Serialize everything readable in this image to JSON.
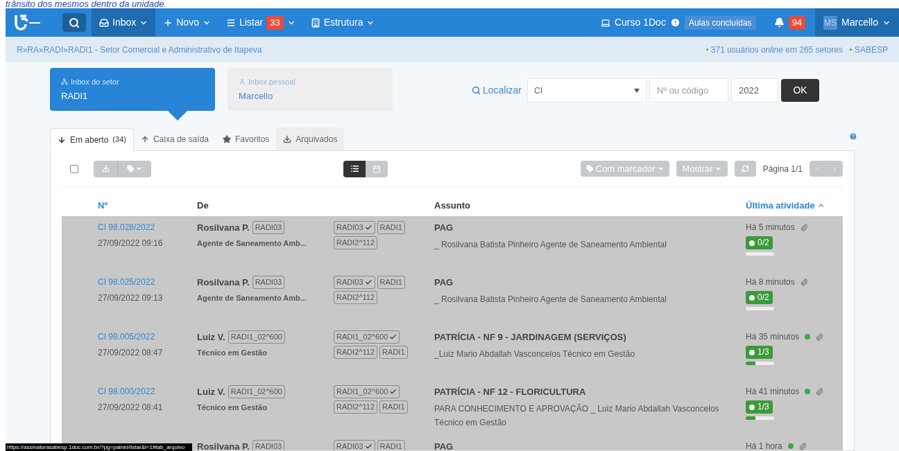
{
  "caption": "trânsito dos mesmos dentro da unidade.",
  "nav": {
    "items": [
      {
        "label": "Inbox",
        "selected": true
      },
      {
        "label": "Novo",
        "selected": false
      },
      {
        "label": "Listar",
        "selected": false,
        "count": "33"
      },
      {
        "label": "Estrutura",
        "selected": false
      }
    ],
    "course": "Curso 1Doc",
    "course_badge": "Aulas concluídas",
    "notifications": "94",
    "avatar": "MS",
    "user": "Marcello"
  },
  "breadcrumb": "R»RA»RADI»RADI1 - Setor Comercial e Administrativo de Itapeva",
  "online": "371 usuários *online* em 265 setores",
  "org": "SABESP",
  "inboxes": [
    {
      "label": "Inbox do setor",
      "value": "RADI1",
      "selected": true
    },
    {
      "label": "Inbox pessoal",
      "value": "Marcello",
      "selected": false
    }
  ],
  "search": {
    "label": "Localizar",
    "type": "CI",
    "number_placeholder": "Nº ou código",
    "year": "2022",
    "submit": "OK"
  },
  "tabs": [
    {
      "label": "Em aberto",
      "count": "(34)",
      "selected": true
    },
    {
      "label": "Caixa de saída",
      "selected": false
    },
    {
      "label": "Favoritos",
      "selected": false
    },
    {
      "label": "Arquivados",
      "selected": false
    }
  ],
  "toolbar": {
    "select_all": false,
    "list_view_selected": true,
    "marker": "Com marcador",
    "show": "Mostrar",
    "page": "Página 1/1"
  },
  "table": {
    "columns": [
      "Nº",
      "De",
      "Assunto",
      "Última atividade"
    ],
    "rows": [
      {
        "number": "CI 98.028/2022",
        "date": "27/09/2022 09:16",
        "from": "Rosilvana P.",
        "from_tag": "RADI03",
        "role": "Agente de Saneamento Amb...",
        "tags": [
          {
            "label": "RADI03",
            "checked": true
          },
          {
            "label": "RADI1",
            "checked": false
          },
          {
            "label": "RADI2^112",
            "checked": false
          }
        ],
        "subject": "PAG",
        "summary": "_ Rosilvana Batista Pinheiro Agente de Saneamento Ambiental",
        "time": "Há 5 minutos",
        "online": false,
        "progress": "0/2"
      },
      {
        "number": "CI 98.025/2022",
        "date": "27/09/2022 09:13",
        "from": "Rosilvana P.",
        "from_tag": "RADI03",
        "role": "Agente de Saneamento Amb...",
        "tags": [
          {
            "label": "RADI03",
            "checked": true
          },
          {
            "label": "RADI1",
            "checked": false
          },
          {
            "label": "RADI2^112",
            "checked": false
          }
        ],
        "subject": "PAG",
        "summary": "_ Rosilvana Batista Pinheiro Agente de Saneamento Ambiental",
        "time": "Há 8 minutos",
        "online": false,
        "progress": "0/2"
      },
      {
        "number": "CI 98.005/2022",
        "date": "27/09/2022 08:47",
        "from": "Luiz V.",
        "from_tag": "RADI1_02^600",
        "role": "Técnico em Gestão",
        "tags": [
          {
            "label": "RADI1_02^600",
            "checked": true
          },
          {
            "label": "RADI2^112",
            "checked": false
          },
          {
            "label": "RADI1",
            "checked": false
          }
        ],
        "subject": "PATRÍCIA - NF 9 - JARDINAGEM (SERVIÇOS)",
        "summary": "_Luiz Mario Abdallah Vasconcelos Técnico em Gestão",
        "time": "Há 35 minutos",
        "online": true,
        "progress": "1/3",
        "level": 0.33
      },
      {
        "number": "CI 98.000/2022",
        "date": "27/09/2022 08:41",
        "from": "Luiz V.",
        "from_tag": "RADI1_02^600",
        "role": "Técnico em Gestão",
        "tags": [
          {
            "label": "RADI1_02^600",
            "checked": true
          },
          {
            "label": "RADI2^112",
            "checked": false
          },
          {
            "label": "RADI1",
            "checked": false
          }
        ],
        "subject": "PATRÍCIA - NF 12 - FLORICULTURA",
        "summary": "PARA CONHECIMENTO E APROVAÇÃO _ Luiz Mario Abdallah Vasconcelos Técnico em Gestão",
        "time": "Há 41 minutos",
        "online": true,
        "progress": "1/3",
        "level": 0.33
      },
      {
        "from": "Rosilvana P.",
        "from_tag": "RADI03",
        "tags": [
          {
            "label": "RADI03",
            "checked": true
          },
          {
            "label": "RADI1",
            "checked": false
          }
        ],
        "subject": "PAG",
        "time": "Há 1 hora",
        "online": true
      }
    ]
  },
  "status_url": "https://assinaturasabesp.1doc.com.br/?pg=painel/listar&l=1#tab_arquivo"
}
